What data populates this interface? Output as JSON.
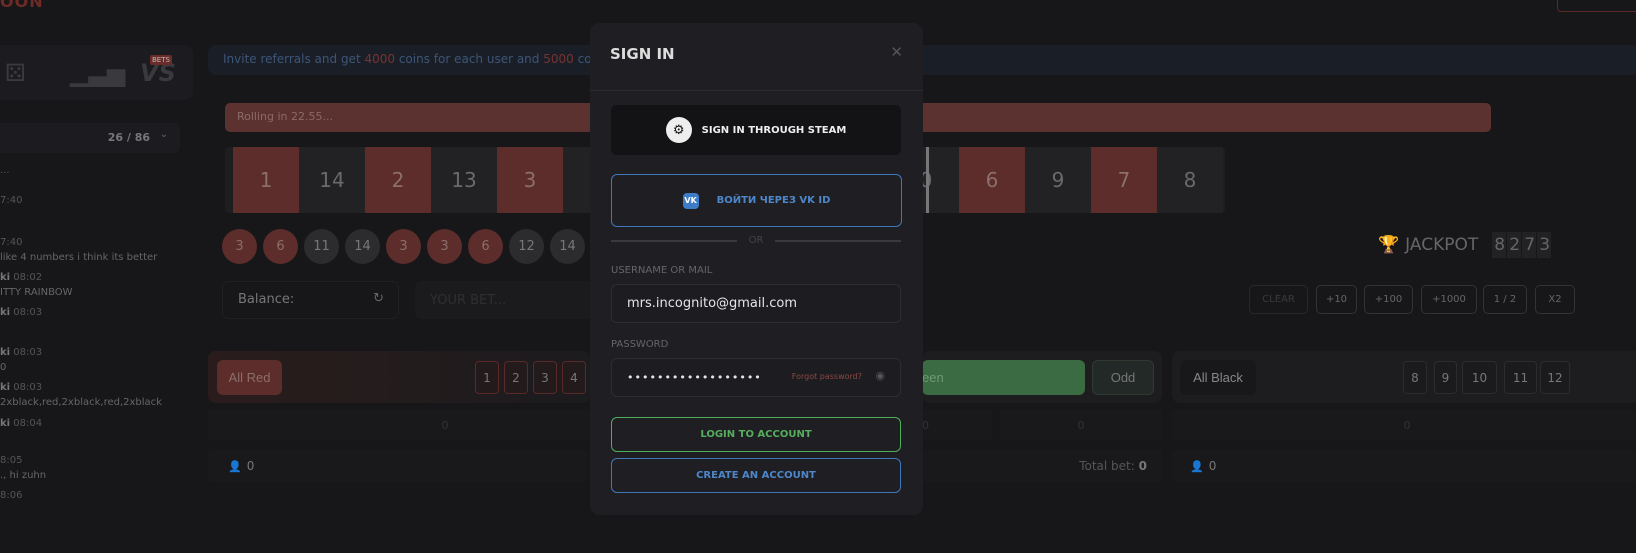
{
  "header": {
    "logo": "OON"
  },
  "sidebar": {
    "games": [
      {
        "icon": "dice-icon"
      },
      {
        "icon": "chart-icon"
      },
      {
        "icon": "versus-icon",
        "badge": "BETS"
      }
    ],
    "chat": {
      "online": "26 / 86",
      "messages": [
        {
          "user": "",
          "time": "...",
          "text": ""
        },
        {
          "user": "",
          "time": "7:40",
          "text": ""
        },
        {
          "user": "",
          "time": "7:40",
          "text": "like 4 numbers i think its better"
        },
        {
          "user": "ki",
          "time": "08:02",
          "text": "ITTY RAINBOW"
        },
        {
          "user": "ki",
          "time": "08:03",
          "text": ""
        },
        {
          "user": "ki",
          "time": "08:03",
          "text": "0"
        },
        {
          "user": "ki",
          "time": "08:03",
          "text": "2xblack,red,2xblack,red,2xblack"
        },
        {
          "user": "ki",
          "time": "08:04",
          "text": ""
        },
        {
          "user": "",
          "time": "8:05",
          "text": "., hi zuhn"
        },
        {
          "user": "",
          "time": "8:06",
          "text": ""
        }
      ]
    }
  },
  "banner": {
    "pre": "Invite referrals and get ",
    "amount1": "4000",
    "mid": " coins for each user and ",
    "amount2": "5000",
    "post": " coins for"
  },
  "roulette": {
    "status": "Rolling in 22.55...",
    "tiles": [
      {
        "n": "1",
        "c": "red"
      },
      {
        "n": "14",
        "c": "black"
      },
      {
        "n": "2",
        "c": "red"
      },
      {
        "n": "13",
        "c": "black"
      },
      {
        "n": "3",
        "c": "red"
      },
      {
        "n": "",
        "c": "black"
      },
      {
        "n": "",
        "c": "red"
      },
      {
        "n": "",
        "c": "black"
      },
      {
        "n": "",
        "c": "red"
      },
      {
        "n": "",
        "c": "black"
      },
      {
        "n": "0",
        "c": "black"
      },
      {
        "n": "6",
        "c": "red"
      },
      {
        "n": "9",
        "c": "black"
      },
      {
        "n": "7",
        "c": "red"
      },
      {
        "n": "8",
        "c": "black"
      }
    ],
    "history": [
      {
        "n": "3",
        "c": "red"
      },
      {
        "n": "6",
        "c": "red"
      },
      {
        "n": "11",
        "c": "black"
      },
      {
        "n": "14",
        "c": "black"
      },
      {
        "n": "3",
        "c": "red"
      },
      {
        "n": "3",
        "c": "red"
      },
      {
        "n": "6",
        "c": "red"
      },
      {
        "n": "12",
        "c": "black"
      },
      {
        "n": "14",
        "c": "black"
      }
    ]
  },
  "jackpot": {
    "label": "JACKPOT",
    "digits": [
      "8",
      "2",
      "7",
      "3"
    ]
  },
  "bet": {
    "balance_label": "Balance:",
    "bet_placeholder": "YOUR BET...",
    "quick": [
      "CLEAR",
      "+10",
      "+100",
      "+1000",
      "1 / 2",
      "X2"
    ]
  },
  "panels": {
    "red": {
      "label": "All Red",
      "numbers": [
        "1",
        "2",
        "3",
        "4"
      ],
      "total": "0",
      "players": "0"
    },
    "green": {
      "label": "een",
      "odd": "Odd",
      "totals": [
        "0",
        "0"
      ],
      "total_bet_label": "Total bet:",
      "total_bet": "0"
    },
    "black": {
      "label": "All Black",
      "numbers": [
        "8",
        "9",
        "10",
        "11",
        "12"
      ],
      "total": "0",
      "players": "0"
    }
  },
  "modal": {
    "title": "SIGN IN",
    "steam_label": "SIGN IN THROUGH STEAM",
    "vk_label": "ВОЙТИ ЧЕРЕЗ VK ID",
    "vk_icon_text": "VK",
    "or": "OR",
    "username_label": "USERNAME OR MAIL",
    "username_value": "mrs.incognito@gmail.com",
    "password_label": "PASSWORD",
    "password_value": "••••••••••••••••••",
    "forgot": "Forgot password?",
    "login": "LOGIN TO ACCOUNT",
    "create": "CREATE AN ACCOUNT"
  },
  "colors": {
    "red": "#5c2d2a",
    "green": "#3a6b42",
    "login_accent": "#4fae5b",
    "vk_accent": "#3f78b8",
    "bg": "#17171a"
  }
}
